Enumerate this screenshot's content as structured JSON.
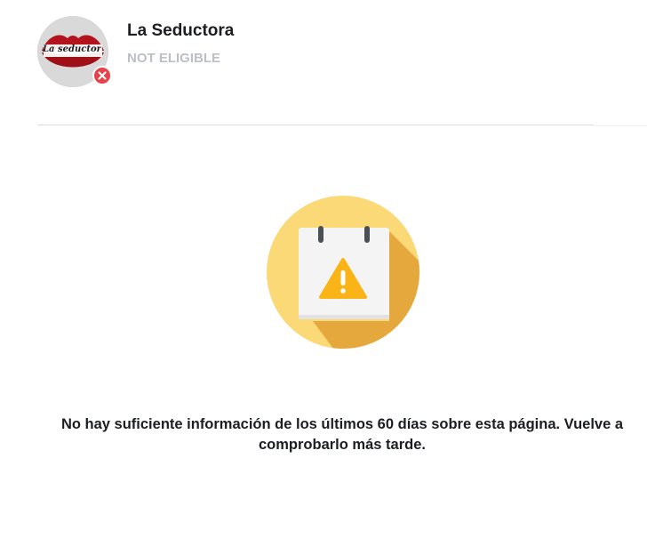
{
  "page": {
    "name": "La Seductora",
    "eligibility_status": "NOT ELIGIBLE",
    "avatar_logo_text": "La seductora",
    "status_icon": "close-icon"
  },
  "empty_state": {
    "icon": "calendar-warning-icon",
    "message": "No hay suficiente información de los últimos 60 días sobre esta página. Vuelve a comprobarlo más tarde."
  },
  "colors": {
    "badge_error": "#e8414a",
    "eligibility_text": "#bcc0c4",
    "illustration_circle": "#fbd977",
    "illustration_shadow": "#e5a83c",
    "warning_triangle": "#fbb417"
  }
}
